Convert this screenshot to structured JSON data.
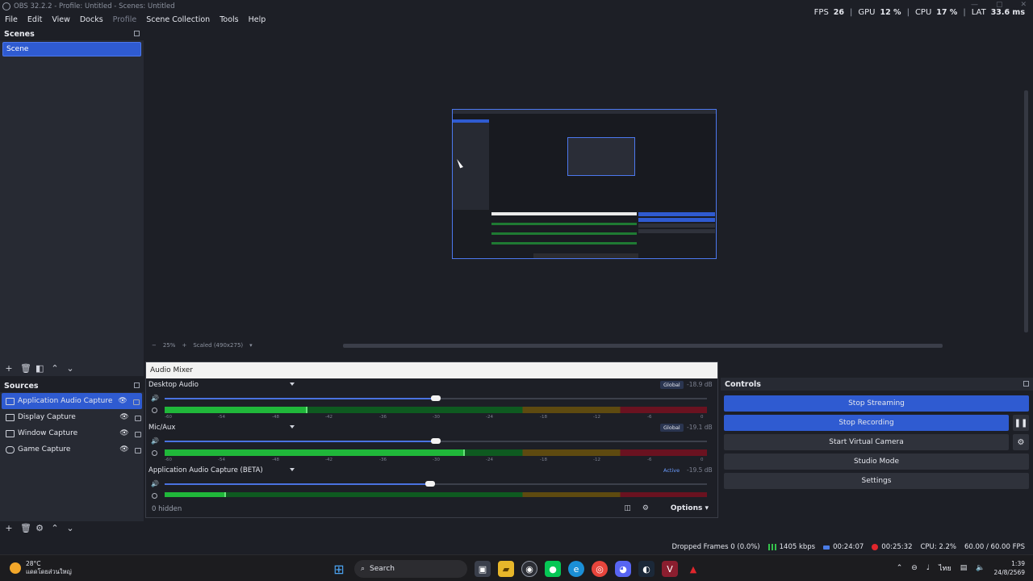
{
  "window": {
    "title": "OBS 32.2.2 - Profile: Untitled - Scenes: Untitled"
  },
  "menu": [
    "File",
    "Edit",
    "View",
    "Docks",
    "Profile",
    "Scene Collection",
    "Tools",
    "Help"
  ],
  "perf": {
    "fps_label": "FPS",
    "fps": "26",
    "gpu_label": "GPU",
    "gpu": "12 %",
    "cpu_label": "CPU",
    "cpu": "17 %",
    "lat_label": "LAT",
    "lat": "33.6 ms"
  },
  "scenes": {
    "title": "Scenes",
    "items": [
      "Scene"
    ]
  },
  "sources": {
    "title": "Sources",
    "items": [
      "Application Audio Capture (B",
      "Display Capture",
      "Window Capture",
      "Game Capture"
    ]
  },
  "preview": {
    "zoom": "25%",
    "scale": "Scaled (490x275)"
  },
  "mixer": {
    "title": "Audio Mixer",
    "channels": [
      {
        "name": "Desktop Audio",
        "badge": "Global",
        "db": "-18.9 dB",
        "volume": 0.5,
        "level": 0.26,
        "peak": 0.26
      },
      {
        "name": "Mic/Aux",
        "badge": "Global",
        "db": "-19.1 dB",
        "volume": 0.5,
        "level": 0.55,
        "peak": 0.55
      },
      {
        "name": "Application Audio Capture (BETA)",
        "badge": "Active",
        "db": "-19.5 dB",
        "volume": 0.49,
        "level": 0.11,
        "peak": 0.11
      }
    ],
    "ticks": [
      "-60",
      "-54",
      "-48",
      "-42",
      "-36",
      "-30",
      "-24",
      "-18",
      "-12",
      "-6",
      "0"
    ],
    "hidden": "0 hidden",
    "options": "Options"
  },
  "controls": {
    "title": "Controls",
    "stop_streaming": "Stop Streaming",
    "stop_recording": "Stop Recording",
    "start_virtual_camera": "Start Virtual Camera",
    "studio_mode": "Studio Mode",
    "settings": "Settings"
  },
  "status": {
    "dropped": "Dropped Frames 0 (0.0%)",
    "bitrate": "1405 kbps",
    "stream_time": "00:24:07",
    "rec_time": "00:25:32",
    "cpu": "CPU: 2.2%",
    "fps": "60.00 / 60.00 FPS"
  },
  "taskbar": {
    "temp": "28°C",
    "weather": "แดดโดยส่วนใหญ่",
    "search": "Search",
    "lang": "ไทย",
    "time": "1:39",
    "date": "24/8/2569"
  },
  "colors": {
    "accent": "#2f5bd1",
    "bg": "#1d1f26",
    "panel": "#272a33"
  }
}
